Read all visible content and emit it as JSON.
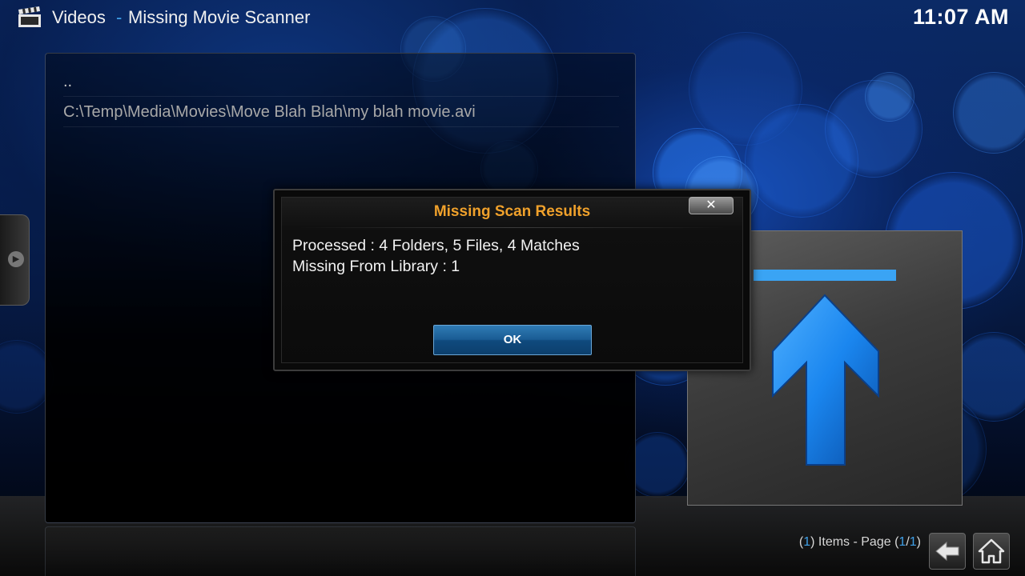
{
  "header": {
    "section": "Videos",
    "separator": "-",
    "title": "Missing Movie Scanner",
    "icon": "clapperboard-icon",
    "clock": "11:07 AM"
  },
  "file_list": {
    "items": [
      {
        "label": ".."
      },
      {
        "label": "C:\\Temp\\Media\\Movies\\Move Blah Blah\\my blah movie.avi"
      }
    ]
  },
  "thumbnail": {
    "icon": "up-arrow-icon"
  },
  "dialog": {
    "title": "Missing Scan Results",
    "lines": [
      "Processed : 4 Folders, 5  Files, 4 Matches",
      "Missing From Library : 1"
    ],
    "ok_label": "OK",
    "close_label": "✕"
  },
  "footer": {
    "item_count": "1",
    "items_text": "Items - Page",
    "page": "1",
    "page_total": "1"
  },
  "colors": {
    "accent": "#3fa0e8",
    "dialog_title": "#f0a12b",
    "ok_button": "#1a5c94"
  }
}
